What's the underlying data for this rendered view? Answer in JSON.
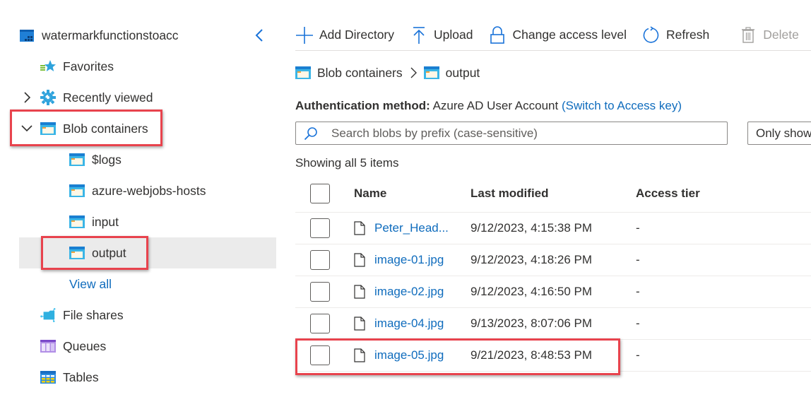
{
  "sidebar": {
    "account_name": "watermarkfunctionstoacc",
    "items": [
      {
        "label": "Favorites",
        "icon": "favorites-star-icon"
      },
      {
        "label": "Recently viewed",
        "icon": "recently-viewed-gear-icon",
        "expanded": false
      },
      {
        "label": "Blob containers",
        "icon": "blob-container-icon",
        "expanded": true,
        "highlighted": true,
        "children": [
          {
            "label": "$logs",
            "icon": "container-icon"
          },
          {
            "label": "azure-webjobs-hosts",
            "icon": "container-icon"
          },
          {
            "label": "input",
            "icon": "container-icon"
          },
          {
            "label": "output",
            "icon": "container-icon",
            "selected": true,
            "highlighted": true
          }
        ],
        "view_all": "View all"
      },
      {
        "label": "File shares",
        "icon": "file-shares-icon"
      },
      {
        "label": "Queues",
        "icon": "queues-icon"
      },
      {
        "label": "Tables",
        "icon": "tables-icon"
      }
    ]
  },
  "toolbar": {
    "add_directory": "Add Directory",
    "upload": "Upload",
    "change_access_level": "Change access level",
    "refresh": "Refresh",
    "delete": "Delete"
  },
  "breadcrumb": {
    "root": "Blob containers",
    "current": "output"
  },
  "auth": {
    "label": "Authentication method:",
    "value": "Azure AD User Account",
    "switch_link": "(Switch to Access key)"
  },
  "search": {
    "placeholder": "Search blobs by prefix (case-sensitive)",
    "value": ""
  },
  "filter": {
    "label": "Only show"
  },
  "listing": {
    "count_text": "Showing all 5 items",
    "columns": {
      "name": "Name",
      "last_modified": "Last modified",
      "access_tier": "Access tier"
    },
    "rows": [
      {
        "name": "Peter_Head...",
        "last_modified": "9/12/2023, 4:15:38 PM",
        "access_tier": "-"
      },
      {
        "name": "image-01.jpg",
        "last_modified": "9/12/2023, 4:18:26 PM",
        "access_tier": "-"
      },
      {
        "name": "image-02.jpg",
        "last_modified": "9/12/2023, 4:16:50 PM",
        "access_tier": "-"
      },
      {
        "name": "image-04.jpg",
        "last_modified": "9/13/2023, 8:07:06 PM",
        "access_tier": "-"
      },
      {
        "name": "image-05.jpg",
        "last_modified": "9/21/2023, 8:48:53 PM",
        "access_tier": "-",
        "highlighted": true
      }
    ]
  },
  "colors": {
    "accent": "#0f6cbd",
    "highlight_box": "#e8434d",
    "selected_bg": "#ebebeb",
    "disabled_text": "#a19f9d"
  }
}
